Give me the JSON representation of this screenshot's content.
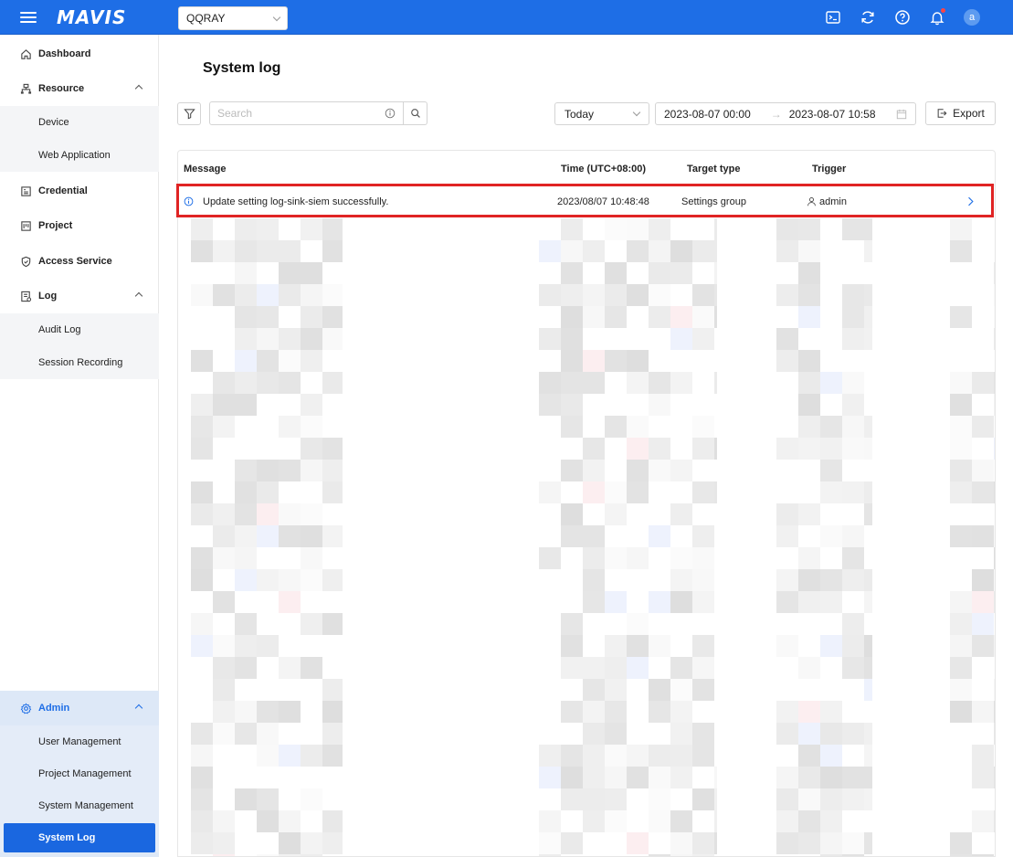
{
  "app": {
    "logo": "MAVIS"
  },
  "header": {
    "tenant": "QQRAY",
    "avatar_letter": "a"
  },
  "sidebar": {
    "items": [
      {
        "label": "Dashboard"
      },
      {
        "label": "Resource",
        "children": [
          "Device",
          "Web Application"
        ]
      },
      {
        "label": "Credential"
      },
      {
        "label": "Project"
      },
      {
        "label": "Access Service"
      },
      {
        "label": "Log",
        "children": [
          "Audit Log",
          "Session Recording"
        ]
      }
    ],
    "admin": {
      "label": "Admin",
      "children": [
        "User Management",
        "Project Management",
        "System Management",
        "System Log"
      ],
      "active": "System Log"
    }
  },
  "main": {
    "title": "System log",
    "search_placeholder": "Search",
    "range": "Today",
    "date_start": "2023-08-07 00:00",
    "date_end": "2023-08-07 10:58",
    "export_label": "Export",
    "columns": {
      "message": "Message",
      "time": "Time  (UTC+08:00)",
      "target_type": "Target type",
      "trigger": "Trigger"
    },
    "rows": [
      {
        "message": "Update setting log-sink-siem successfully.",
        "time": "2023/08/07 10:48:48",
        "target_type": "Settings group",
        "trigger": "admin"
      }
    ]
  },
  "colors": {
    "primary": "#1e6ee6",
    "highlight": "#e02424"
  }
}
